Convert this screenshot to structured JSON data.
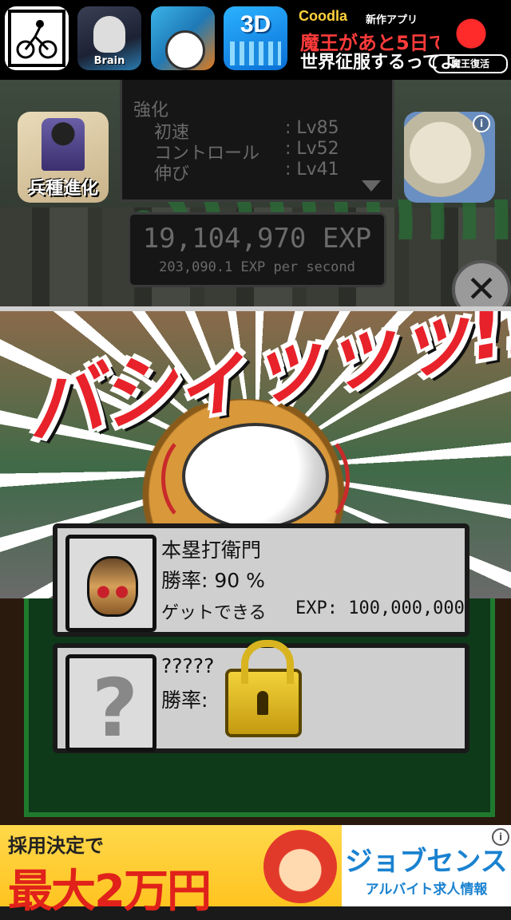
{
  "top_ads": {
    "tiles": [
      {
        "name": "bike-app-icon"
      },
      {
        "name": "brain-app-icon",
        "label": "Brain"
      },
      {
        "name": "baseball-app-icon"
      },
      {
        "name": "3d-app-icon",
        "label": "3D"
      }
    ],
    "promo": {
      "brand": "Coodla",
      "new_label": "新作アプリ",
      "line1": "魔王があと5日で",
      "line2": "世界征服するってよ",
      "badge": "魔王復活"
    }
  },
  "upgrade": {
    "title": "強化",
    "rows": [
      {
        "label": "初速",
        "level": ": Lv85"
      },
      {
        "label": "コントロール",
        "level": ": Lv52"
      },
      {
        "label": "伸び",
        "level": ": Lv41"
      }
    ]
  },
  "evolve_button": {
    "label": "兵種進化"
  },
  "exp": {
    "total": "19,104,970 EXP",
    "rate": "203,090.1 EXP per second"
  },
  "close_button": {
    "label": "✕"
  },
  "hit_banner": {
    "text": "バシィッッッ!!"
  },
  "opponents": [
    {
      "name": "本塁打衛門",
      "win_rate": "勝率: 90 %",
      "get_label": "ゲットできる",
      "exp": "EXP: 100,000,000"
    },
    {
      "name": "?????",
      "win_rate": "勝率:",
      "locked": true
    }
  ],
  "bottom_ad": {
    "line1": "採用決定で",
    "amount": "最大2万円",
    "brand": "ジョブセンス",
    "sub": "アルバイト求人情報",
    "info": "i"
  },
  "colors": {
    "accent_red": "#e8222a",
    "panel_text": "#6a6a6a",
    "frame_green": "#1f7a2e"
  }
}
